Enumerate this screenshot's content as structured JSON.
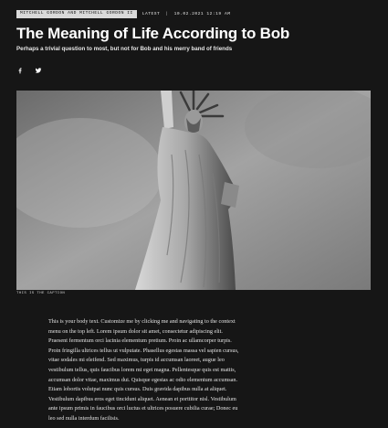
{
  "header": {
    "author_tag": "MITCHELL GORDON AND MITCHELL GORDON II",
    "section": "LATEST",
    "date": "10.02.2021 12:19 AM"
  },
  "article": {
    "title": "The Meaning of Life According to Bob",
    "subtitle": "Perhaps a trivial question to most, but not for Bob and his merry band of friends",
    "social": [
      "facebook-icon",
      "twitter-icon"
    ],
    "caption": "THIS IS THE CAPTION",
    "body": "This is your body text. Customize me by clicking me and navigating to the context menu on the top left. Lorem ipsum dolor sit amet, consectetur adipiscing elit. Praesent fermentum orci lacinia elementum pretium. Proin ac ullamcorper turpis. Proin fringilla ultrices tellus ut vulputate. Phasellus egestas massa vel sapien cursus, vitae sodales mi eleifend. Sed maximus, turpis id accumsan laoreet, augue leo vestibulum tellus, quis faucibus lorem mi eget magna. Pellentesque quis est mattis, accumsan dolor vitae, maximus dui. Quisque egestas ac odio elementum accumsan. Etiam lobortis volutpat nunc quis cursus. Duis gravida dapibus nulla at aliquet. Vestibulum dapibus eros eget tincidunt aliquet. Aenean et porttitor nisl. Vestibulum ante ipsum primis in faucibus orci luctus et ultrices posuere cubilia curae; Donec eu leo sed nulla interdum facilisis."
  },
  "colors": {
    "background": "#161616",
    "text": "#e9e9e9",
    "tag_bg": "#d9d9d9"
  }
}
